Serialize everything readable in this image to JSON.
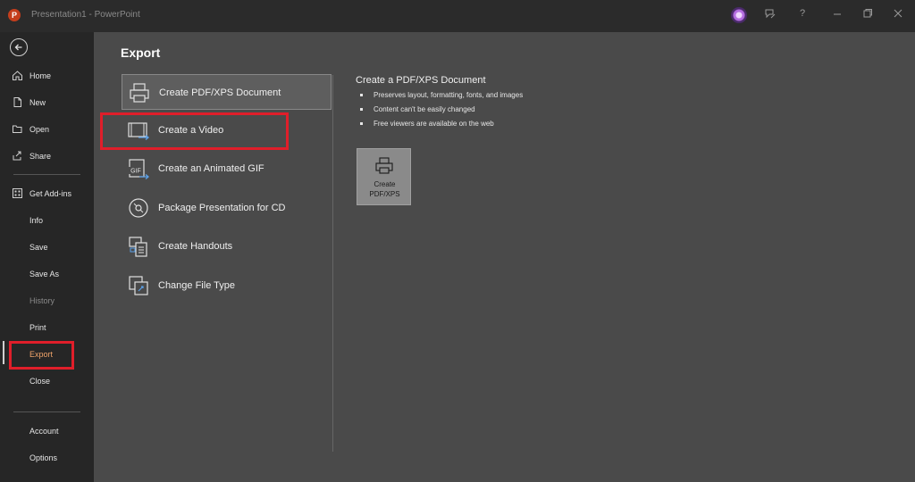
{
  "titlebar": {
    "app_letter": "P",
    "title": "Presentation1 - PowerPoint",
    "icons": [
      "avatar",
      "pen-icon",
      "help-icon",
      "minimize-icon",
      "restore-icon",
      "close-icon"
    ],
    "help_label": "?"
  },
  "sidebar": {
    "back_icon": "back-arrow-icon",
    "items": [
      {
        "label": "Home",
        "icon": "home-icon"
      },
      {
        "label": "New",
        "icon": "new-document-icon"
      },
      {
        "label": "Open",
        "icon": "folder-icon"
      },
      {
        "label": "Share",
        "icon": "share-icon"
      },
      {
        "label": "Get Add-ins",
        "icon": "addins-icon"
      },
      {
        "label": "Info"
      },
      {
        "label": "Save"
      },
      {
        "label": "Save As"
      },
      {
        "label": "History"
      },
      {
        "label": "Print"
      },
      {
        "label": "Export"
      },
      {
        "label": "Close"
      },
      {
        "label": "Account"
      },
      {
        "label": "Options"
      }
    ]
  },
  "main": {
    "title": "Export",
    "options": [
      {
        "label": "Create PDF/XPS Document",
        "icon": "printer-icon"
      },
      {
        "label": "Create a Video",
        "icon": "video-icon"
      },
      {
        "label": "Create an Animated GIF",
        "icon": "gif-icon",
        "icon_text": "GIF"
      },
      {
        "label": "Package Presentation for CD",
        "icon": "cd-icon"
      },
      {
        "label": "Create Handouts",
        "icon": "handouts-icon"
      },
      {
        "label": "Change File Type",
        "icon": "file-type-icon"
      }
    ],
    "detail": {
      "title": "Create a PDF/XPS Document",
      "bullets": [
        "Preserves layout, formatting, fonts, and images",
        "Content can't be easily changed",
        "Free viewers are available on the web"
      ],
      "button_line1": "Create",
      "button_line2": "PDF/XPS"
    }
  },
  "colors": {
    "highlight": "#e01e2a",
    "active_nav": "#f0a46a",
    "app_brand": "#c43e1c"
  }
}
